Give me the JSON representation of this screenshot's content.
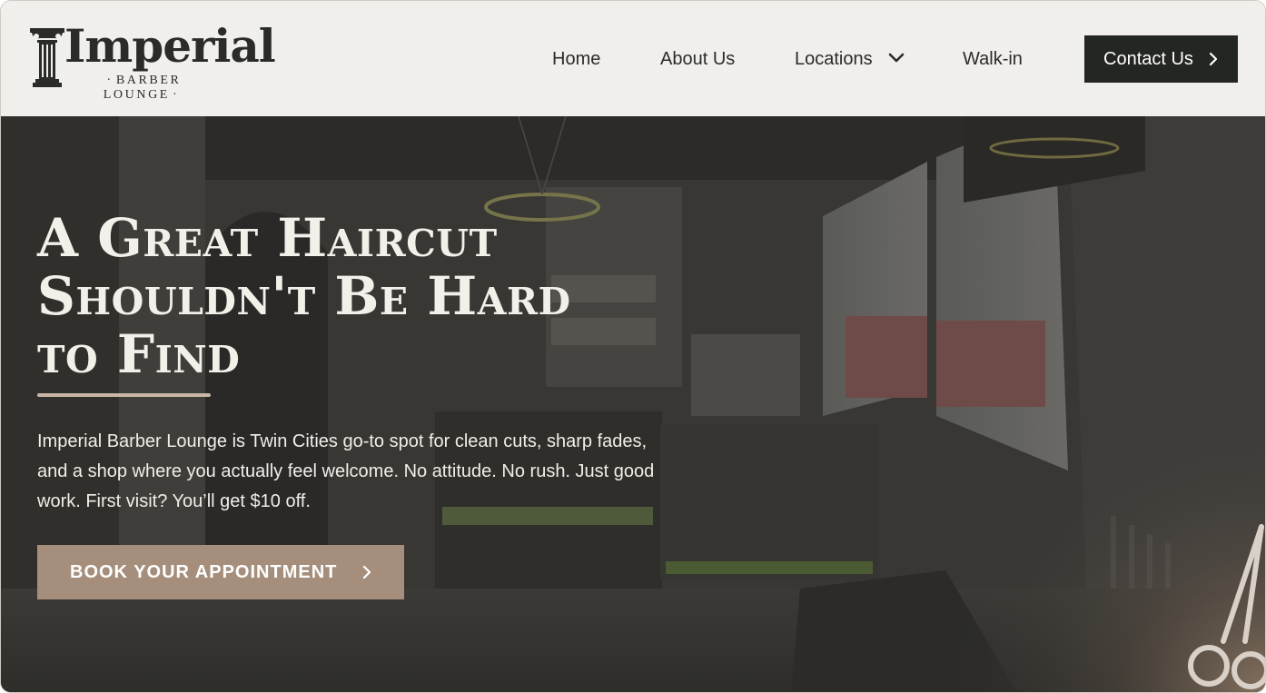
{
  "brand": {
    "logo_word": "Imperial",
    "logo_tagline": "BARBER LOUNGE"
  },
  "nav": {
    "items": [
      {
        "label": "Home"
      },
      {
        "label": "About Us"
      },
      {
        "label": "Locations"
      },
      {
        "label": "Walk-in"
      }
    ],
    "contact_label": "Contact Us"
  },
  "hero": {
    "headline_lines": [
      "A Great Haircut",
      "Shouldn't Be Hard",
      "to Find"
    ],
    "intro": "Imperial Barber Lounge is Twin Cities go-to spot for clean cuts, sharp fades, and a shop where you actually feel welcome. No attitude. No rush. Just good work. First visit? You’ll get $10 off.",
    "cta_label": "BOOK YOUR APPOINTMENT"
  },
  "icons": {
    "logo_column": "column-icon",
    "locations_dropdown": "chevron-down-icon",
    "contact_arrow": "chevron-right-icon",
    "cta_arrow": "chevron-right-icon",
    "decor": "scissors-icon"
  },
  "colors": {
    "header_bg": "#f1efeb",
    "text_dark": "#2b2b28",
    "contact_button_bg": "#242621",
    "cta_button_bg": "#a58f7c",
    "hero_overlay": "#3a3936",
    "accent_rule": "#c8b7a6"
  }
}
